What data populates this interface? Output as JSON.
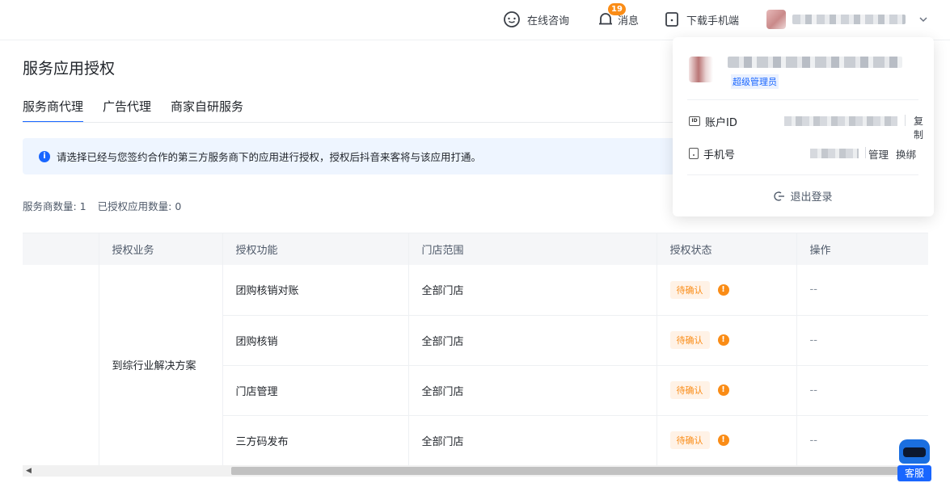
{
  "topbar": {
    "consult_label": "在线咨询",
    "consult_icon": "chat-bubble-icon",
    "messages_label": "消息",
    "messages_badge": "19",
    "messages_icon": "bell-icon",
    "download_label": "下载手机端",
    "download_icon": "phone-icon",
    "user_dropdown_icon": "chevron-down-icon"
  },
  "page": {
    "title": "服务应用授权",
    "tabs": [
      {
        "label": "服务商代理",
        "active": true
      },
      {
        "label": "广告代理",
        "active": false
      },
      {
        "label": "商家自研服务",
        "active": false
      }
    ],
    "notice": "请选择已经与您签约合作的第三方服务商下的应用进行授权，授权后抖音来客将与该应用打通。",
    "stats": {
      "provider_count": "服务商数量: 1",
      "authorized_count": "已授权应用数量: 0"
    }
  },
  "table": {
    "headers": [
      "",
      "授权业务",
      "授权功能",
      "门店范围",
      "授权状态",
      "操作"
    ],
    "business": "到综行业解决方案",
    "rows": [
      {
        "function": "团购核销对账",
        "scope": "全部门店",
        "status": "待确认",
        "action": "--"
      },
      {
        "function": "团购核销",
        "scope": "全部门店",
        "status": "待确认",
        "action": "--"
      },
      {
        "function": "门店管理",
        "scope": "全部门店",
        "status": "待确认",
        "action": "--"
      },
      {
        "function": "三方码发布",
        "scope": "全部门店",
        "status": "待确认",
        "action": "--"
      }
    ]
  },
  "user_card": {
    "role": "超级管理员",
    "account_id_label": "账户ID",
    "copy_label": "复制",
    "phone_label": "手机号",
    "manage_label": "管理",
    "rebind_label": "换绑",
    "logout_label": "退出登录"
  },
  "service_bot": {
    "label": "客服"
  },
  "colors": {
    "accent": "#1966ff",
    "warning": "#fa8c16",
    "notice_bg": "#eef5ff"
  }
}
